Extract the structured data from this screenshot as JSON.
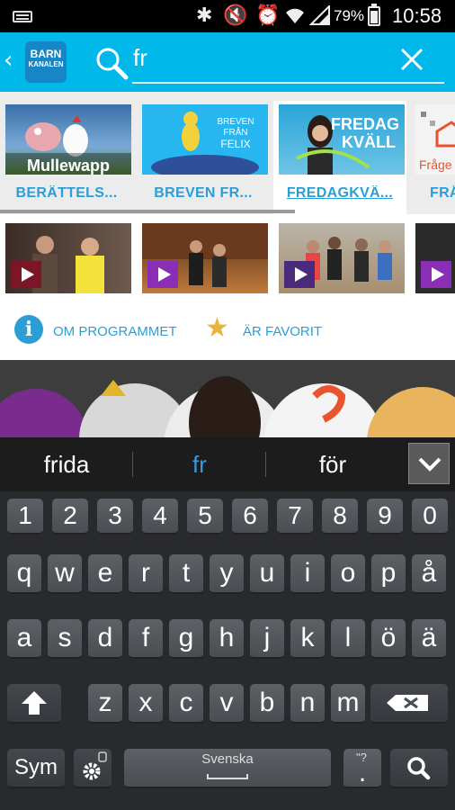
{
  "status_bar": {
    "battery_percent": "79%",
    "battery_level": 0.79,
    "time": "10:58",
    "icons": [
      "keyboard-icon",
      "bluetooth-icon",
      "mute-icon",
      "alarm-icon",
      "wifi-icon",
      "signal-icon",
      "battery-icon"
    ]
  },
  "app_bar": {
    "logo_line1": "BARN",
    "logo_line2": "KANALEN",
    "search_value": "fr",
    "accent": "#00b8ea"
  },
  "programs": [
    {
      "label": "BERÄTTELS...",
      "thumb_text": "Mullewapp"
    },
    {
      "label": "BREVEN FR...",
      "thumb_text": "BREVEN FRÅN FELIX"
    },
    {
      "label": "FREDAGKVÄ...",
      "thumb_text": "FREDAG KVÄLL"
    },
    {
      "label": "FRÅ",
      "thumb_text": "Fråge"
    }
  ],
  "actions": {
    "about": "OM PROGRAMMET",
    "favorite": "ÄR FAVORIT"
  },
  "suggestions": [
    "frida",
    "fr",
    "för"
  ],
  "keyboard": {
    "numbers": [
      "1",
      "2",
      "3",
      "4",
      "5",
      "6",
      "7",
      "8",
      "9",
      "0"
    ],
    "row1": [
      "q",
      "w",
      "e",
      "r",
      "t",
      "y",
      "u",
      "i",
      "o",
      "p",
      "å"
    ],
    "row2": [
      "a",
      "s",
      "d",
      "f",
      "g",
      "h",
      "j",
      "k",
      "l",
      "ö",
      "ä"
    ],
    "row3": [
      "z",
      "x",
      "c",
      "v",
      "b",
      "n",
      "m"
    ],
    "sym": "Sym",
    "space": "Svenska",
    "period_hint": "\"?",
    "period": "."
  }
}
